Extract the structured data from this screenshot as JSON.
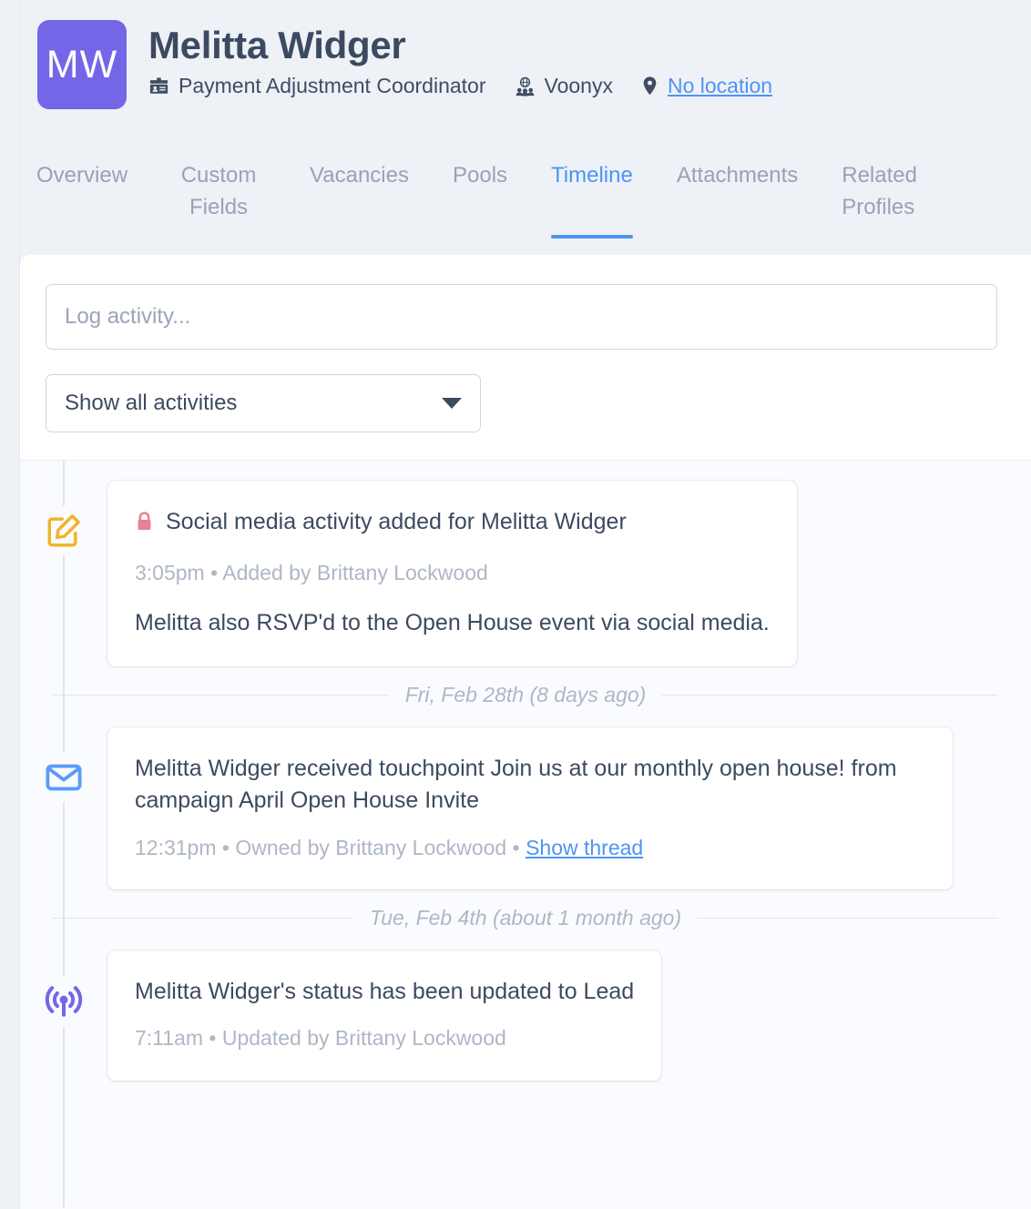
{
  "header": {
    "avatar_initials": "MW",
    "avatar_color": "#7367e8",
    "name": "Melitta Widger",
    "job_title": "Payment Adjustment Coordinator",
    "company": "Voonyx",
    "location_label": "No location",
    "job_icon": "id-badge-icon",
    "company_icon": "globe-group-icon",
    "location_icon": "map-pin-icon"
  },
  "tabs": [
    {
      "label": "Overview",
      "active": false
    },
    {
      "label": "Custom Fields",
      "active": false
    },
    {
      "label": "Vacancies",
      "active": false
    },
    {
      "label": "Pools",
      "active": false
    },
    {
      "label": "Timeline",
      "active": true
    },
    {
      "label": "Attachments",
      "active": false
    },
    {
      "label": "Related Profiles",
      "active": false
    }
  ],
  "composer": {
    "log_placeholder": "Log activity...",
    "log_value": "",
    "filter_selected": "Show all activities",
    "filter_caret_icon": "chevron-down-icon"
  },
  "timeline": [
    {
      "kind": "entry",
      "icon": "pencil-square-icon",
      "icon_color": "#f0b429",
      "has_lock": true,
      "lock_icon": "lock-icon",
      "lock_color": "#e98290",
      "title": "Social media activity added for Melitta Widger",
      "sub": "3:05pm • Added by Brittany Lockwood",
      "body": "Melitta also RSVP'd to the Open House event via social media.",
      "link": ""
    },
    {
      "kind": "divider",
      "label": "Fri, Feb 28th (8 days ago)"
    },
    {
      "kind": "entry",
      "icon": "envelope-icon",
      "icon_color": "#5a9cf8",
      "has_lock": false,
      "title": "Melitta Widger received touchpoint Join us at our monthly open house! from campaign April Open House Invite",
      "sub": "12:31pm • Owned by Brittany Lockwood • ",
      "body": "",
      "link": "Show thread"
    },
    {
      "kind": "divider",
      "label": "Tue, Feb 4th (about 1 month ago)"
    },
    {
      "kind": "entry",
      "icon": "broadcast-icon",
      "icon_color": "#7367e8",
      "has_lock": false,
      "title": "Melitta Widger's status has been updated to Lead",
      "sub": "7:11am • Updated by Brittany Lockwood",
      "body": "",
      "link": ""
    }
  ],
  "colors": {
    "accent_blue": "#4d94f5",
    "page_bg": "#eef1f6",
    "panel_bg": "#fafbfe",
    "text_primary": "#3c4a60",
    "text_muted": "#aeb7c6"
  }
}
